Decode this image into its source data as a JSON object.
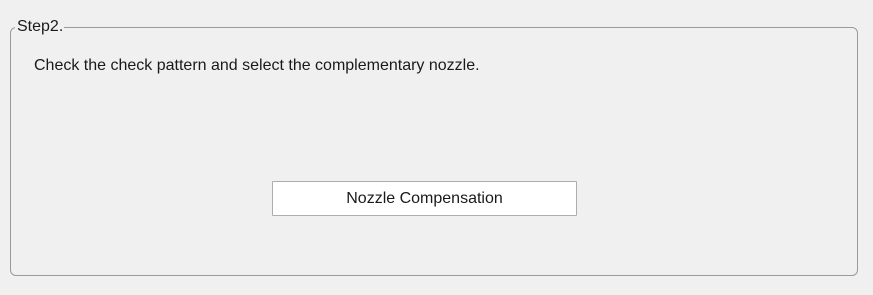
{
  "group": {
    "title": "Step2."
  },
  "instruction": "Check the check pattern and select the complementary nozzle.",
  "buttons": {
    "nozzle_compensation": "Nozzle Compensation"
  }
}
